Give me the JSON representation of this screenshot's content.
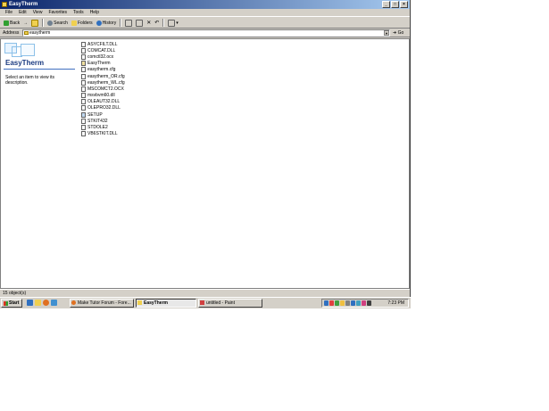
{
  "window": {
    "title": "EasyTherm"
  },
  "menu": [
    "File",
    "Edit",
    "View",
    "Favorites",
    "Tools",
    "Help"
  ],
  "toolbar": {
    "back": "Back",
    "forward_arrow": "→",
    "search": "Search",
    "folders": "Folders",
    "history": "History"
  },
  "address": {
    "label": "Address",
    "value": "easytherm",
    "go": "Go"
  },
  "left_pane": {
    "title": "EasyTherm",
    "description": "Select an item to view its description."
  },
  "files": [
    "ASYCFILT.DLL",
    "COMCAT.DLL",
    "comctl32.ocx",
    "EasyTherm",
    "easytherm.cfg",
    "easytherm_OR.cfg",
    "easytherm_WL.cfg",
    "MSCOMCT2.OCX",
    "msvbvm60.dll",
    "OLEAUT32.DLL",
    "OLEPRO32.DLL",
    "SETUP",
    "STKIT432",
    "STDOLE2",
    "VB6STKIT.DLL"
  ],
  "status": {
    "text": "15 object(s)"
  },
  "taskbar": {
    "start": "Start",
    "tasks": [
      {
        "label": "Make Tutor Forum - Fore..."
      },
      {
        "label": "EasyTherm"
      },
      {
        "label": "untitled - Paint"
      }
    ],
    "clock": "7:23 PM"
  },
  "colors": {
    "title_start": "#0a246a",
    "title_end": "#a6caf0",
    "face": "#d4d0c8"
  }
}
